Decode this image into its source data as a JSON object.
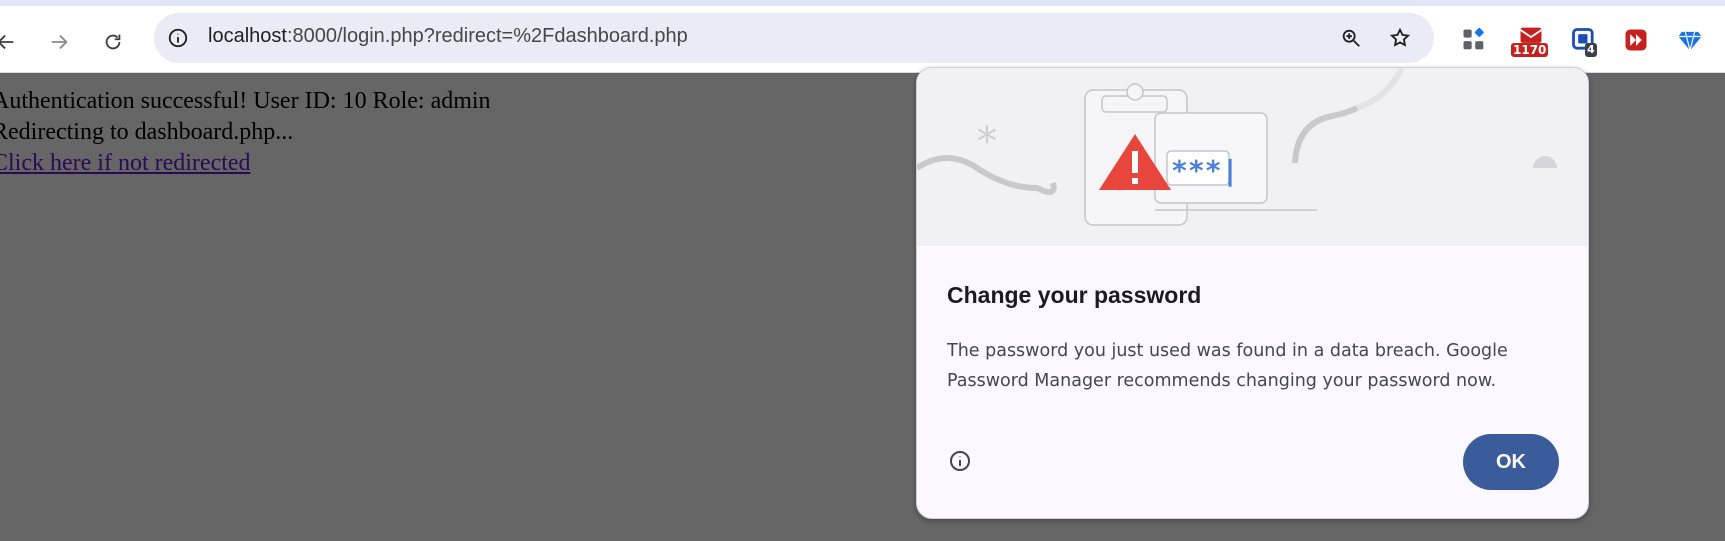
{
  "browser": {
    "url_host": "localhost",
    "url_rest": ":8000/login.php?redirect=%2Fdashboard.php",
    "extension_badges": {
      "mail_count": "1170",
      "tab_count": "4"
    }
  },
  "page": {
    "line1": "Authentication successful! User ID: 10 Role: admin",
    "line2": "Redirecting to dashboard.php...",
    "link": "Click here if not redirected"
  },
  "dialog": {
    "title": "Change your password",
    "body": "The password you just used was found in a data breach. Google Password Manager recommends changing your password now.",
    "ok_label": "OK",
    "illustration_mask": "***|"
  },
  "colors": {
    "overlay": "#666666",
    "ok_button": "#3b5c9a",
    "warning": "#e8453c",
    "password_dots": "#4a7fdc"
  }
}
